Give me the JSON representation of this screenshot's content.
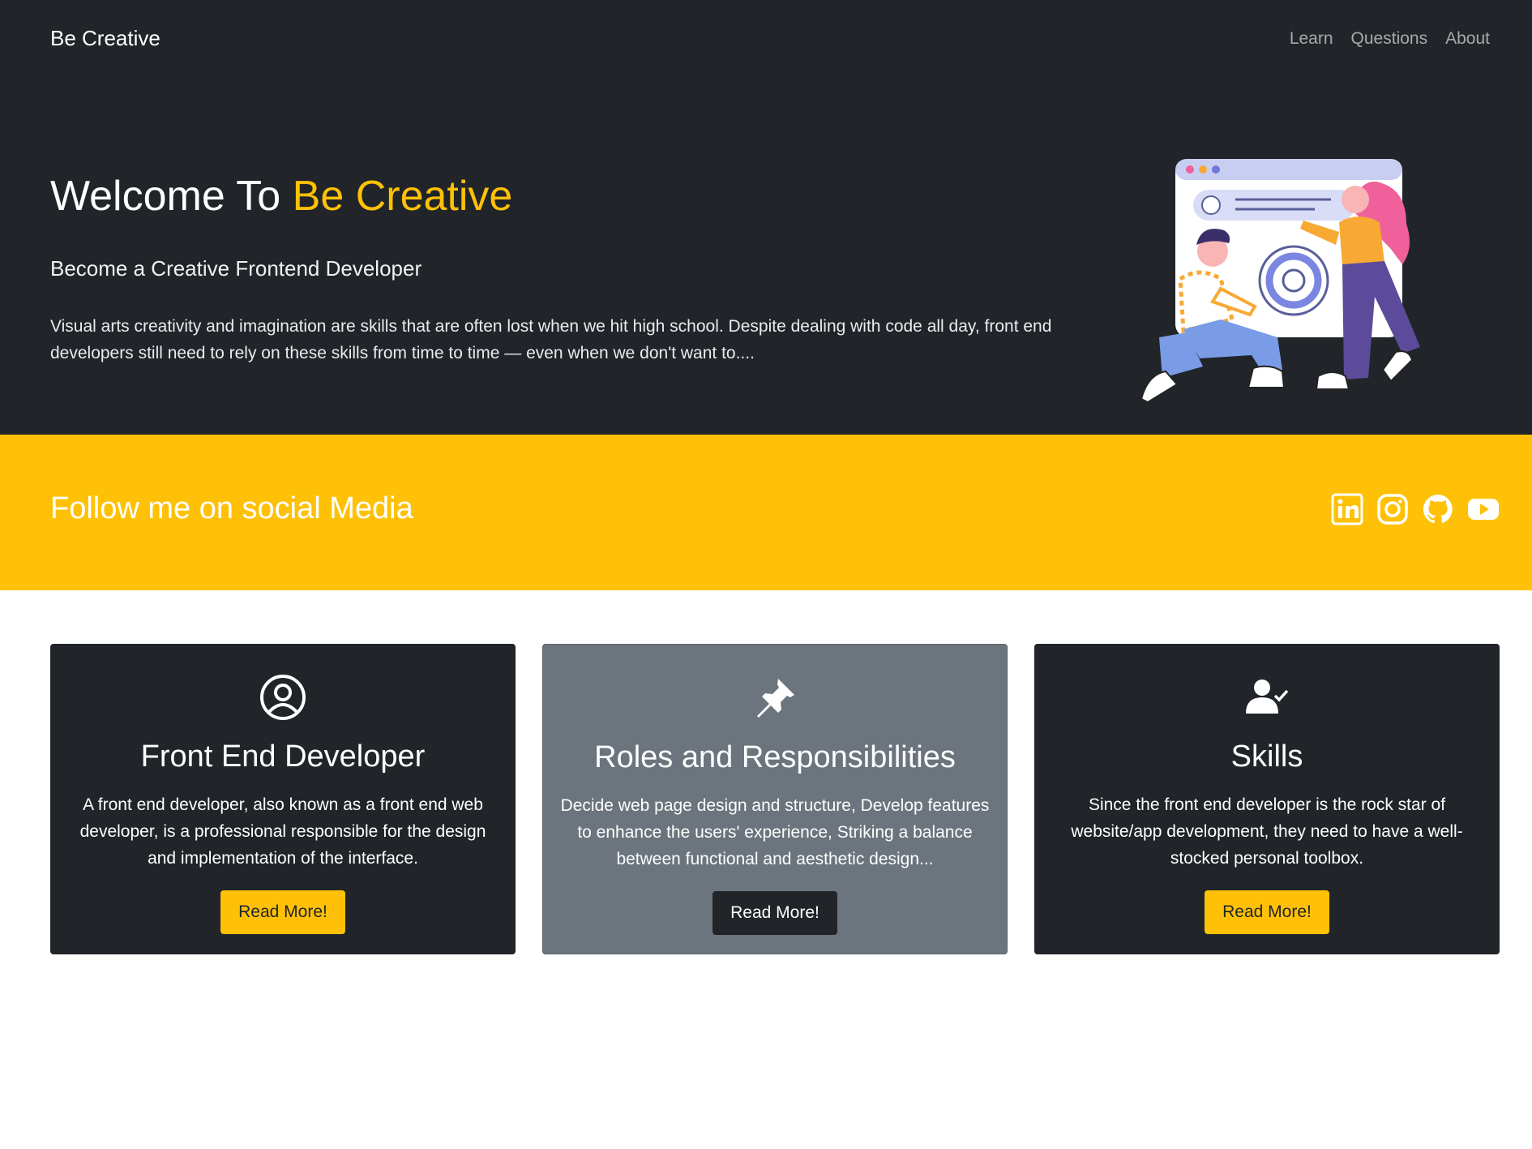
{
  "nav": {
    "brand": "Be Creative",
    "links": [
      "Learn",
      "Questions",
      "About"
    ]
  },
  "hero": {
    "title_prefix": "Welcome To ",
    "title_accent": "Be Creative",
    "subtitle": "Become a Creative Frontend Developer",
    "text": "Visual arts creativity and imagination are skills that are often lost when we hit high school. Despite dealing with code all day, front end developers still need to rely on these skills from time to time — even when we don't want to...."
  },
  "social": {
    "title": "Follow me on social Media",
    "icons": [
      "linkedin-icon",
      "instagram-icon",
      "github-icon",
      "youtube-icon"
    ]
  },
  "cards": [
    {
      "icon": "user-circle-icon",
      "title": "Front End Developer",
      "text": "A front end developer, also known as a front end web developer, is a professional responsible for the design and implementation of the interface.",
      "button": "Read More!"
    },
    {
      "icon": "pin-icon",
      "title": "Roles and Responsibilities",
      "text": "Decide web page design and structure, Develop features to enhance the users' experience, Striking a balance between functional and aesthetic design...",
      "button": "Read More!"
    },
    {
      "icon": "user-check-icon",
      "title": "Skills",
      "text": "Since the front end developer is the rock star of website/app development, they need to have a well-stocked personal toolbox.",
      "button": "Read More!"
    }
  ],
  "colors": {
    "dark": "#212529",
    "accent": "#ffc107",
    "gray": "#6c757d"
  }
}
